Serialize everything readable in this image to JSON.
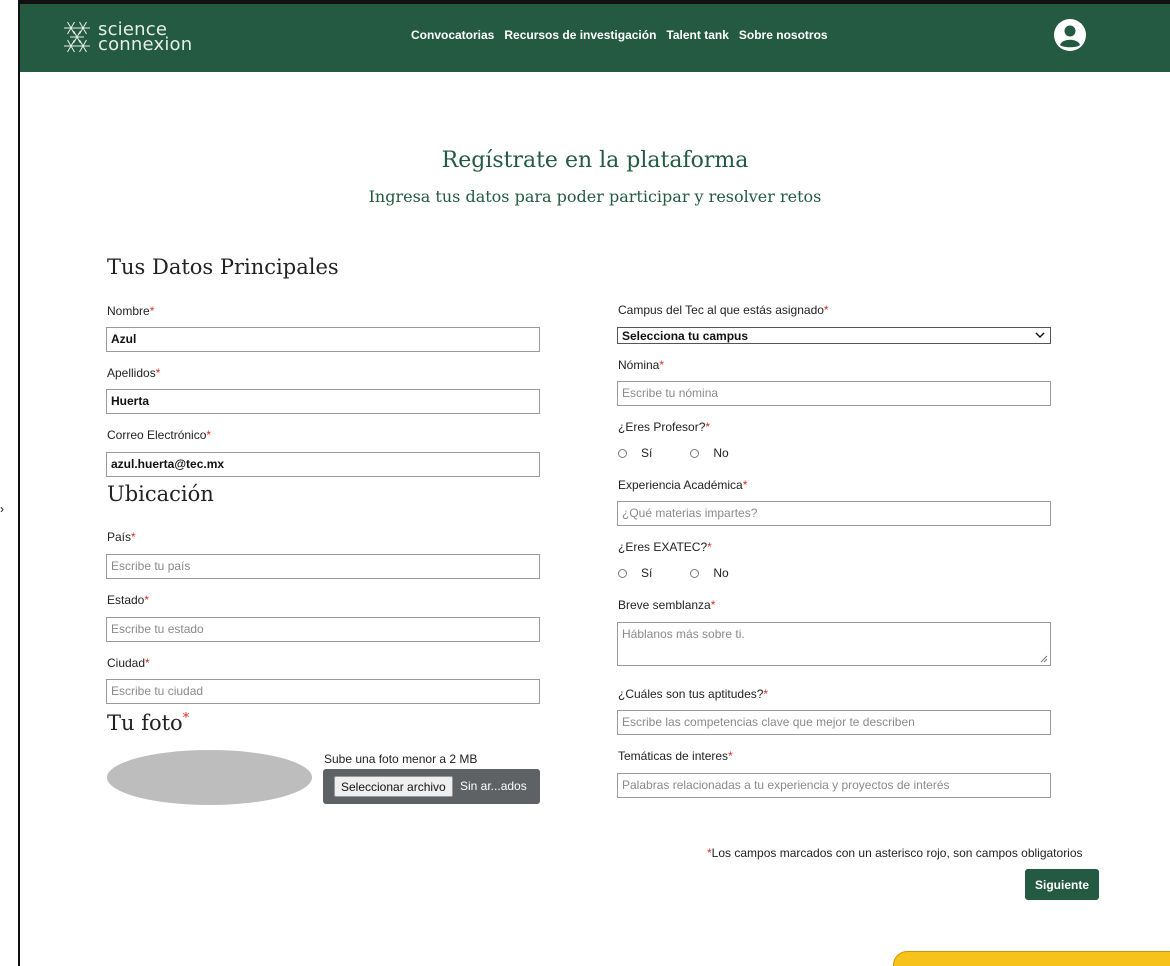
{
  "edge_mark": "›",
  "header": {
    "logo_line1": "science",
    "logo_line2": "connexion",
    "nav": [
      "Convocatorias",
      "Recursos de investigación",
      "Talent tank",
      "Sobre nosotros"
    ]
  },
  "page": {
    "title": "Regístrate en la plataforma",
    "subtitle": "Ingresa tus datos para poder participar y resolver retos"
  },
  "asterisk": "*",
  "datos": {
    "heading": "Tus Datos Principales",
    "nombre_label": "Nombre",
    "nombre_value": "Azul",
    "apellidos_label": "Apellidos",
    "apellidos_value": "Huerta",
    "correo_label": "Correo Electrónico",
    "correo_value": "azul.huerta@tec.mx"
  },
  "ubicacion": {
    "heading": "Ubicación",
    "pais_label": "País",
    "pais_placeholder": "Escribe tu país",
    "estado_label": "Estado",
    "estado_placeholder": "Escribe tu estado",
    "ciudad_label": "Ciudad",
    "ciudad_placeholder": "Escribe tu ciudad"
  },
  "foto": {
    "heading": "Tu foto",
    "hint": "Sube una foto menor a 2 MB",
    "button_label": "Seleccionar archivo",
    "status": "Sin ar...ados"
  },
  "right": {
    "campus_label": "Campus del Tec al que estás asignado",
    "campus_selected": "Selecciona tu campus",
    "nomina_label": "Nómina",
    "nomina_placeholder": "Escribe tu nómina",
    "profesor_label": "¿Eres Profesor?",
    "exatec_label": "¿Eres EXATEC?",
    "yes": "Sí",
    "no": "No",
    "experiencia_label": "Experiencia Académica",
    "experiencia_placeholder": "¿Qué materias impartes?",
    "semblanza_label": "Breve semblanza",
    "semblanza_placeholder": "Háblanos más sobre ti.",
    "aptitudes_label": "¿Cuáles son tus aptitudes?",
    "aptitudes_placeholder": "Escribe las competencias clave que mejor te describen",
    "tematicas_label": "Temáticas de interes",
    "tematicas_placeholder": "Palabras relacionadas a tu experiencia y proyectos de interés"
  },
  "footer": {
    "note": "Los campos marcados con un asterisco rojo, son campos obligatorios",
    "next_label": "Siguiente"
  },
  "colors": {
    "brand_green": "#235a41",
    "required_red": "#d0302b",
    "chat_tab_yellow": "#f7c21a"
  }
}
